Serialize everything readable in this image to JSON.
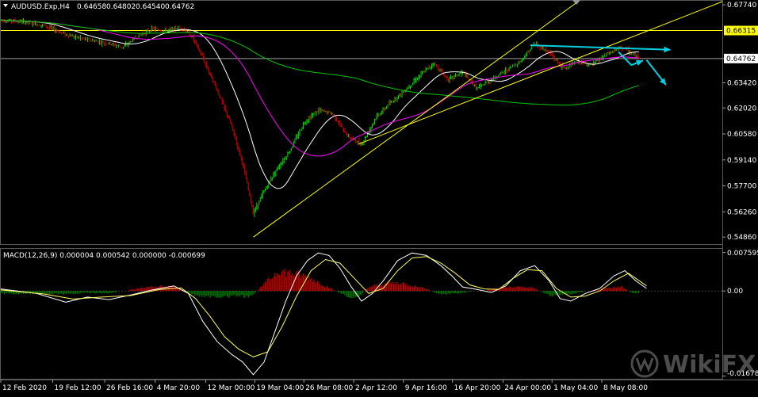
{
  "chart_data": [
    {
      "type": "candlestick",
      "header": {
        "symbol": "AUDUSD.Exp,H4",
        "open": "0.64658",
        "high": "0.64802",
        "low": "0.64540",
        "close": "0.64762"
      },
      "y_ticks": [
        {
          "value": 0.6774,
          "label": "0.67740"
        },
        {
          "value": 0.64762,
          "label": "0.64762"
        },
        {
          "value": 0.6342,
          "label": "0.63420"
        },
        {
          "value": 0.6202,
          "label": "0.62020"
        },
        {
          "value": 0.6058,
          "label": "0.60580"
        },
        {
          "value": 0.5914,
          "label": "0.59140"
        },
        {
          "value": 0.577,
          "label": "0.57700"
        },
        {
          "value": 0.5626,
          "label": "0.56260"
        },
        {
          "value": 0.5486,
          "label": "0.54860"
        }
      ],
      "ylim": [
        0.5456,
        0.6792
      ],
      "xlim": [
        0,
        100
      ],
      "x_ticks": [
        {
          "x": 0,
          "label": "12 Feb 2020"
        },
        {
          "x": 7.2,
          "label": "19 Feb 12:00"
        },
        {
          "x": 14.4,
          "label": "26 Feb 16:00"
        },
        {
          "x": 21.4,
          "label": "4 Mar 20:00"
        },
        {
          "x": 28.4,
          "label": "12 Mar 00:00"
        },
        {
          "x": 35.2,
          "label": "19 Mar 04:00"
        },
        {
          "x": 42.0,
          "label": "26 Mar 08:00"
        },
        {
          "x": 48.9,
          "label": "2 Apr 12:00"
        },
        {
          "x": 55.8,
          "label": "9 Apr 16:00"
        },
        {
          "x": 62.6,
          "label": "16 Apr 20:00"
        },
        {
          "x": 69.6,
          "label": "24 Apr 00:00"
        },
        {
          "x": 76.4,
          "label": "1 May 04:00"
        },
        {
          "x": 83.3,
          "label": "8 May 08:00"
        }
      ],
      "horizontal_lines": [
        {
          "value": 0.66315,
          "label": "0.66315",
          "color": "#ffff00"
        },
        {
          "value": 0.64762,
          "label": "0.64762",
          "color": "#a0a0a0"
        }
      ],
      "price_path": [
        [
          0,
          0.669
        ],
        [
          3,
          0.668
        ],
        [
          6,
          0.666
        ],
        [
          9,
          0.661
        ],
        [
          12,
          0.658
        ],
        [
          15,
          0.656
        ],
        [
          17,
          0.654
        ],
        [
          19,
          0.66
        ],
        [
          21,
          0.664
        ],
        [
          23,
          0.663
        ],
        [
          25,
          0.665
        ],
        [
          26.5,
          0.66
        ],
        [
          28,
          0.648
        ],
        [
          30,
          0.63
        ],
        [
          32,
          0.61
        ],
        [
          33.5,
          0.59
        ],
        [
          35,
          0.562
        ],
        [
          36.5,
          0.574
        ],
        [
          38,
          0.585
        ],
        [
          40,
          0.596
        ],
        [
          42,
          0.612
        ],
        [
          44,
          0.619
        ],
        [
          46,
          0.617
        ],
        [
          48,
          0.605
        ],
        [
          50,
          0.6
        ],
        [
          52,
          0.615
        ],
        [
          54,
          0.623
        ],
        [
          56,
          0.63
        ],
        [
          58,
          0.638
        ],
        [
          60,
          0.645
        ],
        [
          62,
          0.636
        ],
        [
          64,
          0.64
        ],
        [
          66,
          0.631
        ],
        [
          68,
          0.636
        ],
        [
          70,
          0.641
        ],
        [
          72,
          0.646
        ],
        [
          74,
          0.656
        ],
        [
          76,
          0.651
        ],
        [
          78,
          0.642
        ],
        [
          80,
          0.646
        ],
        [
          82,
          0.644
        ],
        [
          84,
          0.65
        ],
        [
          86,
          0.654
        ],
        [
          87.5,
          0.65
        ],
        [
          88.5,
          0.6476
        ]
      ],
      "moving_averages": [
        {
          "color": "#ffffff",
          "period": 5
        },
        {
          "color": "#ff00ff",
          "period": 13
        },
        {
          "color": "#00c800",
          "period": 50
        }
      ],
      "trendlines": [
        {
          "color": "#ffff00",
          "points": [
            [
              35.0,
              0.5486
            ],
            [
              80.0,
              0.6792
            ]
          ]
        },
        {
          "color": "#ffff00",
          "points": [
            [
              49.5,
              0.6
            ],
            [
              100,
              0.6792
            ]
          ]
        },
        {
          "color": "#00d0e0",
          "points": [
            [
              73.4,
              0.655
            ],
            [
              92.8,
              0.6525
            ]
          ],
          "arrow": true
        },
        {
          "color": "#00d0e0",
          "points": [
            [
              85.6,
              0.6513
            ],
            [
              87.4,
              0.644
            ],
            [
              89.0,
              0.6465
            ]
          ],
          "arrow": true
        },
        {
          "color": "#00d0e0",
          "points": [
            [
              89.5,
              0.6468
            ],
            [
              92.2,
              0.633
            ]
          ],
          "arrow": true
        }
      ]
    },
    {
      "type": "macd",
      "title": "MACD(12,26,9) 0.000004 0.000542 0.000000 -0.000699",
      "y_ticks": [
        {
          "value": 0.007595,
          "label": "0.007595"
        },
        {
          "value": 0.0,
          "label": "0.00"
        },
        {
          "value": -0.016785,
          "label": "-0.016785"
        }
      ],
      "ylim": [
        -0.017,
        0.008
      ],
      "macd_path": [
        [
          0,
          0.0004
        ],
        [
          5,
          -0.0005
        ],
        [
          9,
          -0.0022
        ],
        [
          12,
          -0.0012
        ],
        [
          15,
          -0.0017
        ],
        [
          18,
          -0.0008
        ],
        [
          21,
          0.0002
        ],
        [
          24,
          0.001
        ],
        [
          26,
          -0.0005
        ],
        [
          28,
          -0.006
        ],
        [
          30,
          -0.01
        ],
        [
          32,
          -0.0125
        ],
        [
          33.5,
          -0.014
        ],
        [
          35,
          -0.0165
        ],
        [
          36.5,
          -0.014
        ],
        [
          38,
          -0.008
        ],
        [
          39.5,
          -0.002
        ],
        [
          41,
          0.003
        ],
        [
          42.5,
          0.006
        ],
        [
          44,
          0.0075
        ],
        [
          45.5,
          0.007
        ],
        [
          47,
          0.0045
        ],
        [
          48.5,
          0.001
        ],
        [
          50,
          -0.002
        ],
        [
          51.5,
          -0.0005
        ],
        [
          53,
          0.002
        ],
        [
          55,
          0.006
        ],
        [
          57,
          0.0075
        ],
        [
          59,
          0.007
        ],
        [
          61,
          0.005
        ],
        [
          62.5,
          0.003
        ],
        [
          64,
          0.0008
        ],
        [
          66,
          0.0003
        ],
        [
          68,
          -0.0003
        ],
        [
          70,
          0.001
        ],
        [
          72,
          0.004
        ],
        [
          74,
          0.005
        ],
        [
          76,
          0.002
        ],
        [
          77.5,
          -0.0015
        ],
        [
          79,
          -0.002
        ],
        [
          81,
          -0.0005
        ],
        [
          83,
          0.0005
        ],
        [
          85,
          0.003
        ],
        [
          86.5,
          0.004
        ],
        [
          88,
          0.002
        ],
        [
          89.5,
          0.0005
        ]
      ],
      "signal_path": [
        [
          0,
          0.0002
        ],
        [
          6,
          -0.0006
        ],
        [
          10,
          -0.0016
        ],
        [
          14,
          -0.0012
        ],
        [
          18,
          -0.0009
        ],
        [
          22,
          0.0003
        ],
        [
          25,
          0.0006
        ],
        [
          27,
          -0.0015
        ],
        [
          29,
          -0.005
        ],
        [
          31,
          -0.009
        ],
        [
          33,
          -0.0115
        ],
        [
          35,
          -0.013
        ],
        [
          37,
          -0.012
        ],
        [
          39,
          -0.007
        ],
        [
          41,
          -0.001
        ],
        [
          43,
          0.004
        ],
        [
          45,
          0.0062
        ],
        [
          47,
          0.0055
        ],
        [
          49,
          0.0025
        ],
        [
          51,
          -0.0005
        ],
        [
          53,
          0.0005
        ],
        [
          55,
          0.004
        ],
        [
          57,
          0.0065
        ],
        [
          59,
          0.0068
        ],
        [
          61,
          0.0055
        ],
        [
          63,
          0.0035
        ],
        [
          65,
          0.0012
        ],
        [
          67,
          0.0004
        ],
        [
          69,
          0.0003
        ],
        [
          71,
          0.0025
        ],
        [
          73,
          0.0042
        ],
        [
          75,
          0.004
        ],
        [
          77,
          0.0005
        ],
        [
          79,
          -0.0012
        ],
        [
          81,
          -0.001
        ],
        [
          83,
          0.0
        ],
        [
          85,
          0.002
        ],
        [
          87,
          0.0035
        ],
        [
          89.5,
          0.001
        ]
      ],
      "histogram": [
        [
          10,
          -0.0006
        ],
        [
          12,
          -0.0004
        ],
        [
          15,
          -0.0005
        ],
        [
          20,
          0.0008
        ],
        [
          22,
          0.001
        ],
        [
          24,
          0.0009
        ],
        [
          27,
          -0.001
        ],
        [
          29,
          -0.0012
        ],
        [
          31,
          -0.0013
        ],
        [
          33,
          -0.001
        ],
        [
          34.5,
          -0.0015
        ],
        [
          37,
          0.0022
        ],
        [
          38.5,
          0.0045
        ],
        [
          40,
          0.004
        ],
        [
          41.5,
          0.0035
        ],
        [
          43,
          0.0028
        ],
        [
          44.5,
          0.0015
        ],
        [
          48,
          -0.0012
        ],
        [
          49.5,
          -0.0014
        ],
        [
          51,
          0.0008
        ],
        [
          52.5,
          0.0014
        ],
        [
          54,
          0.0018
        ],
        [
          56,
          0.0016
        ],
        [
          57.5,
          0.001
        ],
        [
          59,
          0.0005
        ],
        [
          60.5,
          -0.0006
        ],
        [
          62,
          -0.0007
        ],
        [
          64,
          -0.0004
        ],
        [
          70,
          0.0008
        ],
        [
          72,
          0.0009
        ],
        [
          74,
          0.0006
        ],
        [
          76,
          -0.001
        ],
        [
          77.5,
          -0.0008
        ],
        [
          79,
          -0.0006
        ],
        [
          84,
          0.0006
        ],
        [
          86,
          0.001
        ],
        [
          87.5,
          -0.0004
        ],
        [
          89,
          -0.0006
        ]
      ]
    }
  ],
  "watermark": {
    "text": "WikiFX"
  }
}
